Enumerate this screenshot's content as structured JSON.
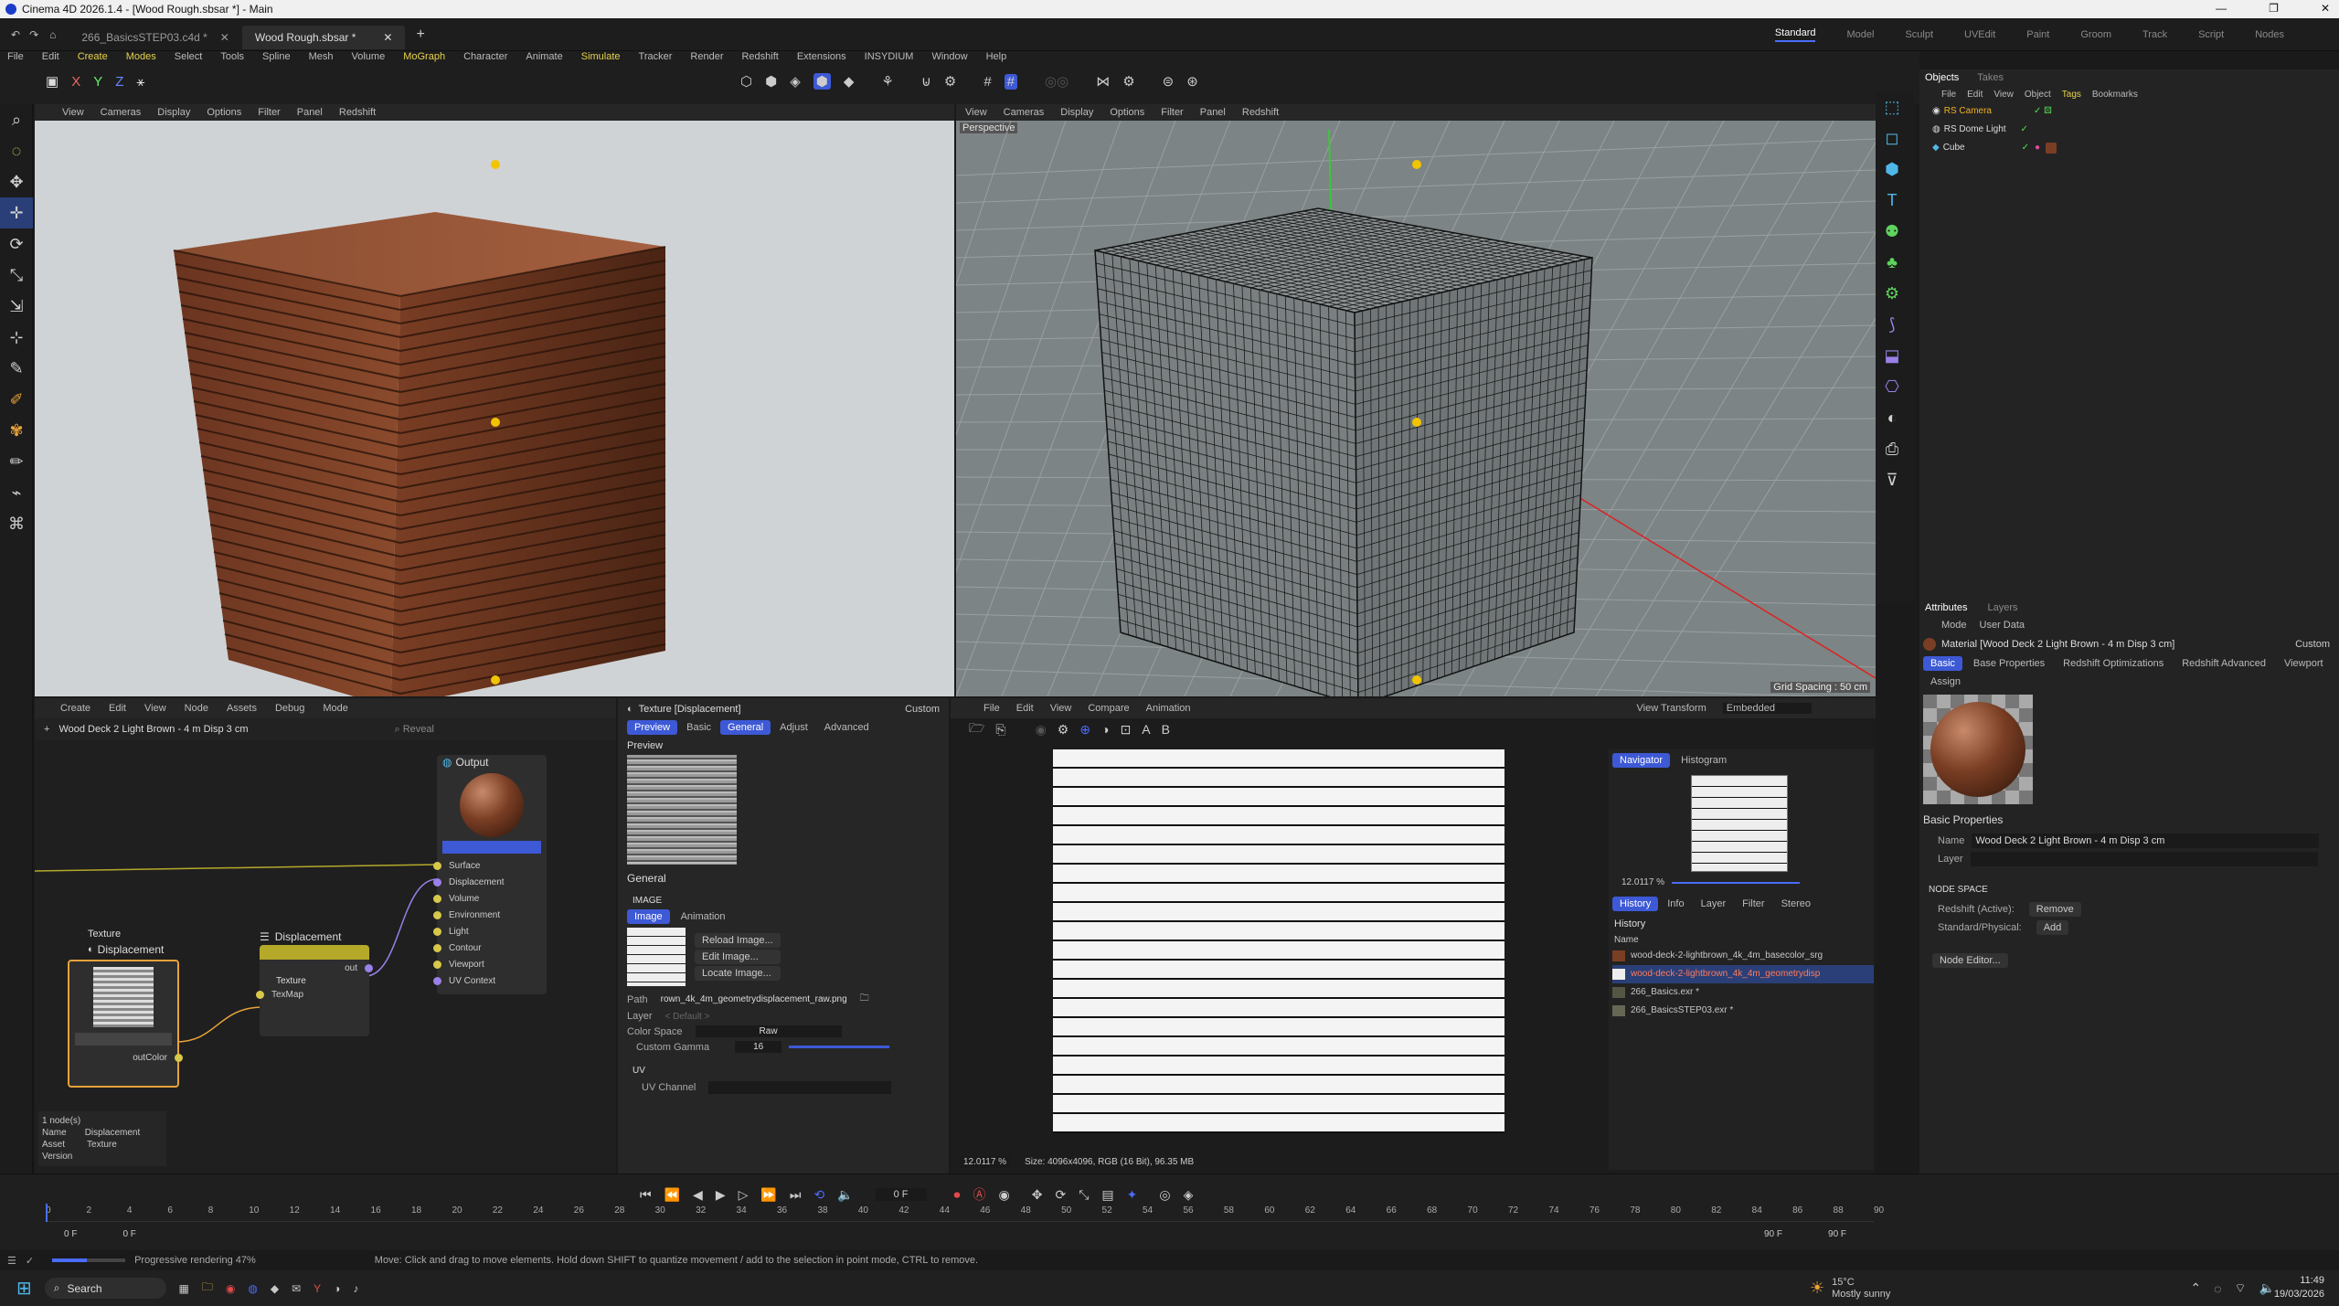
{
  "window": {
    "title": "Cinema 4D 2026.1.4 - [Wood Rough.sbsar *] - Main"
  },
  "tabs": [
    {
      "label": "266_BasicsSTEP03.c4d *"
    },
    {
      "label": "Wood Rough.sbsar *"
    }
  ],
  "layouts": [
    "Standard",
    "Model",
    "Sculpt",
    "UVEdit",
    "Paint",
    "Groom",
    "Track",
    "Script",
    "Nodes"
  ],
  "menu": [
    "File",
    "Edit",
    "Create",
    "Modes",
    "Select",
    "Tools",
    "Spline",
    "Mesh",
    "Volume",
    "MoGraph",
    "Character",
    "Animate",
    "Simulate",
    "Tracker",
    "Render",
    "Redshift",
    "Extensions",
    "INSYDIUM",
    "Window",
    "Help"
  ],
  "viewport_menu": [
    "View",
    "Cameras",
    "Display",
    "Options",
    "Filter",
    "Panel",
    "Redshift"
  ],
  "viewport2": {
    "label": "Perspective",
    "grid": "Grid Spacing : 50 cm"
  },
  "objects": {
    "tabs": [
      "Objects",
      "Takes"
    ],
    "menu": [
      "File",
      "Edit",
      "View",
      "Object",
      "Tags",
      "Bookmarks"
    ],
    "items": [
      "RS Camera",
      "RS Dome Light",
      "Cube"
    ]
  },
  "attributes": {
    "tabs": [
      "Attributes",
      "Layers"
    ],
    "mode": [
      "Mode",
      "User Data"
    ],
    "material": "Material [Wood Deck 2 Light Brown - 4 m Disp 3 cm]",
    "preset": "Custom",
    "subtabs": [
      "Basic",
      "Base Properties",
      "Redshift Optimizations",
      "Redshift Advanced",
      "Viewport"
    ],
    "assign": "Assign",
    "section": "Basic Properties",
    "name_label": "Name",
    "name_value": "Wood Deck 2 Light Brown - 4 m Disp 3 cm",
    "layer_label": "Layer",
    "node_space": "NODE SPACE",
    "redshift_active": "Redshift (Active):",
    "remove": "Remove",
    "standard": "Standard/Physical:",
    "add": "Add",
    "node_editor": "Node Editor..."
  },
  "node_editor": {
    "menu": [
      "Create",
      "Edit",
      "View",
      "Node",
      "Assets",
      "Debug",
      "Mode"
    ],
    "material": "Wood Deck 2 Light Brown - 4 m Disp 3 cm",
    "search": "Reveal",
    "output": {
      "title": "Output",
      "ports": [
        "Surface",
        "Displacement",
        "Volume",
        "Environment",
        "Light",
        "Contour",
        "Viewport",
        "UV Context"
      ],
      "out": "out"
    },
    "texture_node": {
      "title1": "Texture",
      "title2": "Displacement",
      "port": "outColor"
    },
    "disp_node": {
      "title": "Displacement",
      "group": "Texture",
      "port": "TexMap",
      "out": "out"
    },
    "info": {
      "count": "1 node(s)",
      "name_label": "Name",
      "name": "Displacement",
      "asset_label": "Asset",
      "asset": "Texture",
      "version_label": "Version"
    }
  },
  "texture_panel": {
    "title": "Texture [Displacement]",
    "preset": "Custom",
    "tabs": [
      "Preview",
      "Basic",
      "General",
      "Adjust",
      "Advanced"
    ],
    "preview": "Preview",
    "general": "General",
    "image_section": "IMAGE",
    "image_tabs": [
      "Image",
      "Animation"
    ],
    "buttons": [
      "Reload Image...",
      "Edit Image...",
      "Locate Image..."
    ],
    "path_label": "Path",
    "path": "rown_4k_4m_geometrydisplacement_raw.png",
    "layer_label": "Layer",
    "layer_value": "< Default >",
    "colorspace_label": "Color Space",
    "colorspace": "Raw",
    "gamma_label": "Custom Gamma",
    "gamma": "16",
    "uv_section": "UV",
    "uv_label": "UV Channel"
  },
  "picture_viewer": {
    "menu": [
      "File",
      "Edit",
      "View",
      "Compare",
      "Animation"
    ],
    "view_transform_label": "View Transform",
    "view_transform": "Embedded",
    "zoom": "12.0117 %",
    "size": "Size: 4096x4096, RGB (16 Bit), 96.35 MB",
    "nav_tabs": [
      "Navigator",
      "Histogram"
    ],
    "nav_zoom": "12.0117 %",
    "hist_tabs": [
      "History",
      "Info",
      "Layer",
      "Filter",
      "Stereo"
    ],
    "history_title": "History",
    "name_col": "Name",
    "history": [
      "wood-deck-2-lightbrown_4k_4m_basecolor_srg",
      "wood-deck-2-lightbrown_4k_4m_geometrydisp",
      "266_Basics.exr *",
      "266_BasicsSTEP03.exr *"
    ]
  },
  "timeline": {
    "ticks": [
      "0",
      "2",
      "4",
      "6",
      "8",
      "10",
      "12",
      "14",
      "16",
      "18",
      "20",
      "22",
      "24",
      "26",
      "28",
      "30",
      "32",
      "34",
      "36",
      "38",
      "40",
      "42",
      "44",
      "46",
      "48",
      "50",
      "52",
      "54",
      "56",
      "58",
      "60",
      "62",
      "64",
      "66",
      "68",
      "70",
      "72",
      "74",
      "76",
      "78",
      "80",
      "82",
      "84",
      "86",
      "88",
      "90"
    ],
    "frame": "0 F",
    "start": "0 F",
    "start2": "0 F",
    "end": "90 F",
    "end2": "90 F"
  },
  "status": {
    "render": "Progressive rendering 47%",
    "hint": "Move: Click and drag to move elements. Hold down SHIFT to quantize movement / add to the selection in point mode, CTRL to remove."
  },
  "taskbar": {
    "search": "Search",
    "temp": "15°C",
    "weather": "Mostly sunny",
    "time": "11:49",
    "date": "19/03/2026"
  },
  "colors": {
    "accent": "#3d59d6",
    "node_yellow": "#b5a92a",
    "selection": "#e8a23a"
  }
}
